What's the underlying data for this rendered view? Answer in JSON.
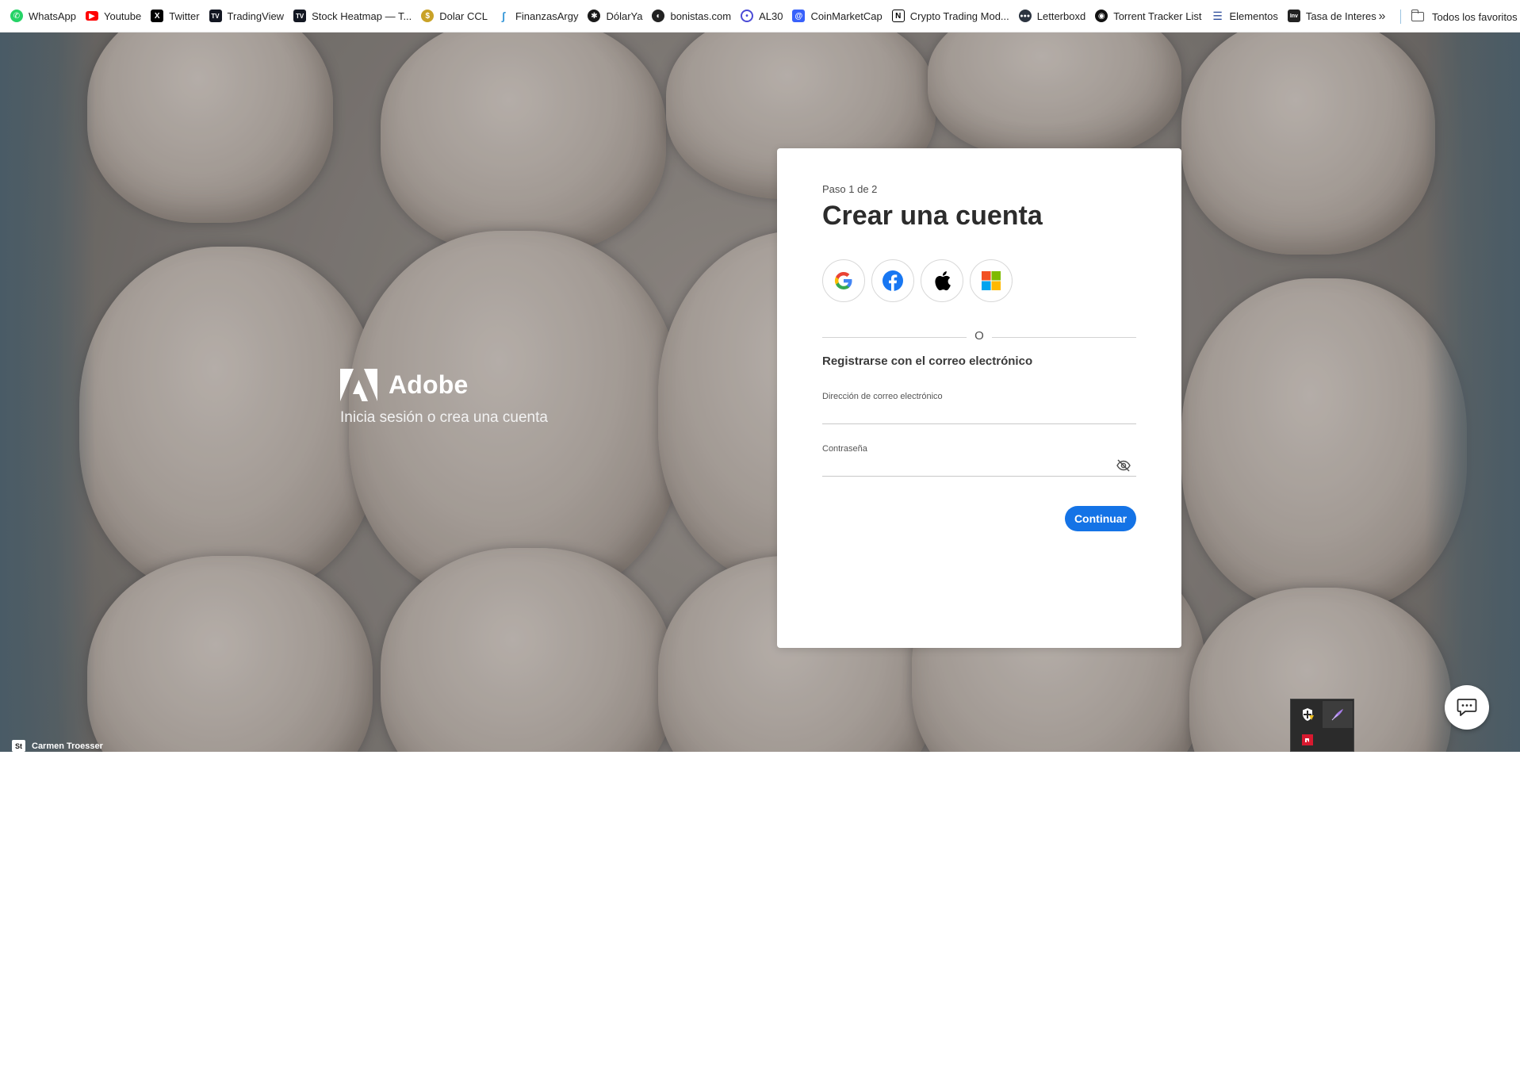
{
  "bookmarks": {
    "items": [
      {
        "label": "WhatsApp",
        "icon": "whatsapp-icon",
        "color": "#25d366"
      },
      {
        "label": "Youtube",
        "icon": "youtube-icon",
        "color": "#ff0000"
      },
      {
        "label": "Twitter",
        "icon": "x-icon",
        "color": "#000000"
      },
      {
        "label": "TradingView",
        "icon": "tradingview-icon",
        "color": "#131722"
      },
      {
        "label": "Stock Heatmap — T...",
        "icon": "tradingview-icon",
        "color": "#131722"
      },
      {
        "label": "Dolar CCL",
        "icon": "coin-icon",
        "color": "#c9a227"
      },
      {
        "label": "FinanzasArgy",
        "icon": "finanzas-icon",
        "color": "#3b9ad9"
      },
      {
        "label": "DólarYa",
        "icon": "dolarya-icon",
        "color": "#1a1a1a"
      },
      {
        "label": "bonistas.com",
        "icon": "bonistas-icon",
        "color": "#222222"
      },
      {
        "label": "AL30",
        "icon": "al30-icon",
        "color": "#4b4bd6"
      },
      {
        "label": "CoinMarketCap",
        "icon": "coinmarketcap-icon",
        "color": "#3861fb"
      },
      {
        "label": "Crypto Trading Mod...",
        "icon": "notion-icon",
        "color": "#000000"
      },
      {
        "label": "Letterboxd",
        "icon": "letterboxd-icon",
        "color": "#2c3440"
      },
      {
        "label": "Torrent Tracker List",
        "icon": "torrent-icon",
        "color": "#111111"
      },
      {
        "label": "Elementos",
        "icon": "elementos-icon",
        "color": "#2a4a9a"
      },
      {
        "label": "Tasa de Interes",
        "icon": "investing-icon",
        "color": "#222222"
      }
    ],
    "more_icon": "chevron-double-right-icon",
    "all_favorites": "Todos los favoritos"
  },
  "brand": {
    "name": "Adobe",
    "tagline": "Inicia sesión o crea una cuenta"
  },
  "form": {
    "step": "Paso 1 de 2",
    "title": "Crear una cuenta",
    "social": [
      "google-icon",
      "facebook-icon",
      "apple-icon",
      "microsoft-icon"
    ],
    "divider_text": "O",
    "register_label": "Registrarse con el correo electrónico",
    "email_label": "Dirección de correo electrónico",
    "email_value": "",
    "password_label": "Contraseña",
    "password_value": "",
    "continue_label": "Continuar",
    "accent_color": "#1473e6"
  },
  "credit": {
    "badge": "St",
    "name": "Carmen Troesser"
  }
}
